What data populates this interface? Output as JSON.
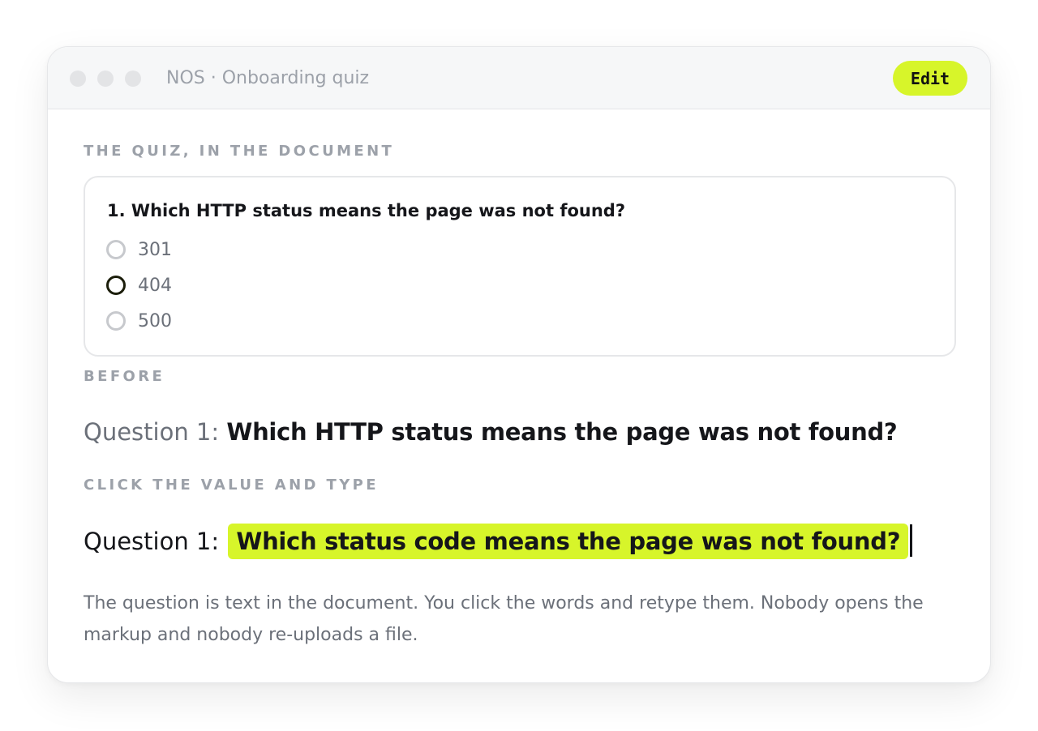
{
  "window": {
    "title": "NOS · Onboarding quiz",
    "edit_label": "Edit"
  },
  "sections": {
    "quiz_label": "THE QUIZ, IN THE DOCUMENT",
    "before_label": "BEFORE",
    "after_label": "CLICK THE VALUE AND TYPE"
  },
  "quiz": {
    "question": "1. Which HTTP status means the page was not found?",
    "options": [
      {
        "label": "301",
        "selected": false
      },
      {
        "label": "404",
        "selected": true
      },
      {
        "label": "500",
        "selected": false
      }
    ]
  },
  "before": {
    "prefix": "Question 1: ",
    "text": "Which HTTP status means the page was not found?"
  },
  "after": {
    "prefix": "Question 1: ",
    "text": "Which status code means the page was not found?"
  },
  "description": "The question is text in the document. You click the words and retype them. Nobody opens the markup and nobody re-uploads a file.",
  "colors": {
    "accent": "#d7f52a",
    "muted": "#9ca1a9",
    "text": "#15161a"
  }
}
